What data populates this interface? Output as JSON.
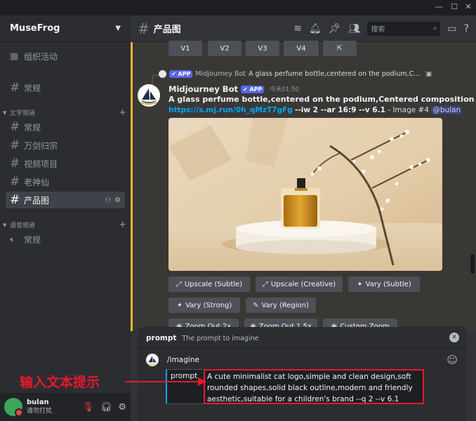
{
  "window": {
    "minimize": "—",
    "maximize": "☐",
    "close": "✕"
  },
  "server": {
    "name": "MuseFrog"
  },
  "sidebar": {
    "event_label": "组织活动",
    "top_channel": "常规",
    "categories": [
      {
        "name": "文字频道"
      },
      {
        "name": "语音频道"
      }
    ],
    "text_channels": [
      {
        "label": "常规"
      },
      {
        "label": "万剑归宗"
      },
      {
        "label": "视频项目"
      },
      {
        "label": "老神仙"
      },
      {
        "label": "产品图"
      }
    ],
    "voice_channels": [
      {
        "label": "常规"
      }
    ]
  },
  "user": {
    "name": "bulan",
    "status": "请勿打扰"
  },
  "channel": {
    "name": "产品图",
    "search_placeholder": "搜索"
  },
  "variation_buttons": [
    "V1",
    "V2",
    "V3",
    "V4"
  ],
  "reply": {
    "author": "Midjourney Bot",
    "badge": "APP",
    "snippet": "A glass perfume bottle,centered on the podium,C..."
  },
  "message": {
    "author": "Midjourney Bot",
    "badge": "APP",
    "time": "今天01:50",
    "prompt": "A glass perfume bottle,centered on the podium,Centered composition",
    "link": "https://s.mj.run/0h_qMzT7gFg",
    "params": "--iw 2 --ar 16:9 --v 6.1",
    "suffix": " - Image #4 ",
    "mention": "@bulan"
  },
  "action_buttons": {
    "row1": [
      "Upscale (Subtle)",
      "Upscale (Creative)",
      "Vary (Subtle)"
    ],
    "row2": [
      "Vary (Strong)",
      "Vary (Region)"
    ],
    "row3": [
      "Zoom Out 2x",
      "Zoom Out 1.5x",
      "Custom Zoom"
    ]
  },
  "command": {
    "param_name": "prompt",
    "param_desc": "The prompt to imagine",
    "command_name": "/imagine",
    "chip_label": "prompt",
    "input_value": "A cute minimalist cat logo,simple and clean design,soft rounded shapes,solid black outline,modern and friendly aesthetic,suitable for a children's brand --q 2 --v 6.1"
  },
  "annotation": {
    "text": "输入文本提示"
  },
  "colors": {
    "accent_red": "#e8182d",
    "link_blue": "#00a8fc",
    "app_badge": "#5865f2",
    "highlight": "#f0b232"
  }
}
